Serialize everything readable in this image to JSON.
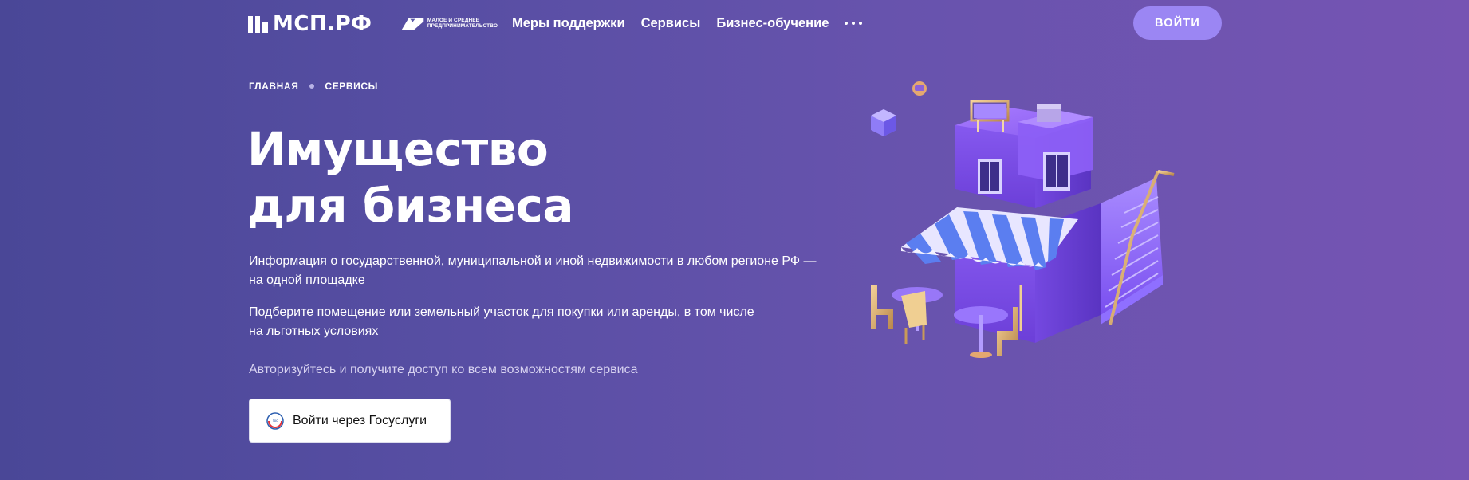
{
  "header": {
    "logo_text": "МСП.РФ",
    "mb_logo_text_line1": "МАЛОЕ И СРЕДНЕЕ",
    "mb_logo_text_line2": "ПРЕДПРИНИМАТЕЛЬСТВО",
    "nav": [
      {
        "label": "Меры поддержки"
      },
      {
        "label": "Сервисы"
      },
      {
        "label": "Бизнес-обучение"
      }
    ],
    "more_icon": "more-dots-icon",
    "login_label": "ВОЙТИ"
  },
  "breadcrumb": {
    "items": [
      {
        "label": "ГЛАВНАЯ"
      },
      {
        "label": "СЕРВИСЫ"
      }
    ]
  },
  "hero": {
    "title_line1": "Имущество",
    "title_line2": "для бизнеса",
    "description1": "Информация о государственной, муниципальной и иной недвижимости в любом регионе РФ — на одной площадке",
    "description2_line1": "Подберите помещение или земельный участок для покупки или аренды, в том числе",
    "description2_line2": "на льготных условиях",
    "auth_note": "Авторизуйтесь и получите доступ ко всем возможностям сервиса",
    "gosuslugi_button": "Войти через Госуслуги",
    "gosuslugi_icon": "gosuslugi-logo-icon"
  },
  "colors": {
    "background_left": "#4a4797",
    "background_right": "#7654b3",
    "login_button": "#9b86f3",
    "building": "#8a5cf0"
  }
}
